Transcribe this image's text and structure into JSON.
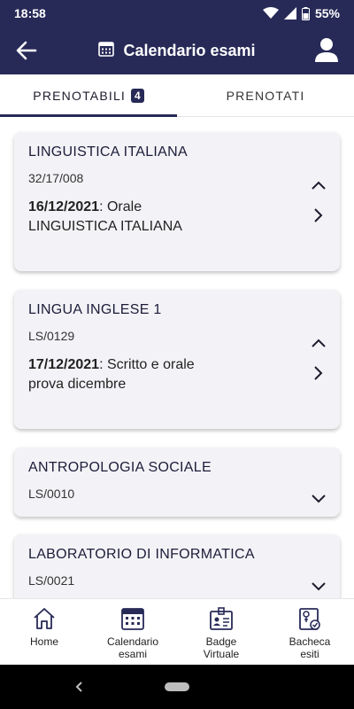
{
  "status_bar": {
    "time": "18:58",
    "battery": "55%",
    "icons": [
      "wifi-icon",
      "signal-icon",
      "battery-icon"
    ]
  },
  "header": {
    "title": "Calendario esami",
    "icons": [
      "back-arrow-icon",
      "calendar-icon",
      "profile-icon"
    ]
  },
  "tabs": [
    {
      "label": "PRENOTABILI",
      "badge": "4",
      "active": true
    },
    {
      "label": "PRENOTATI",
      "active": false
    }
  ],
  "cards": [
    {
      "title": "LINGUISTICA ITALIANA",
      "code": "32/17/008",
      "expanded": true,
      "exam": {
        "date": "16/12/2021",
        "type": ": Orale",
        "description": "LINGUISTICA ITALIANA"
      }
    },
    {
      "title": "LINGUA INGLESE 1",
      "code": "LS/0129",
      "expanded": true,
      "exam": {
        "date": "17/12/2021",
        "type": ": Scritto e orale",
        "description": "prova dicembre"
      }
    },
    {
      "title": "ANTROPOLOGIA SOCIALE",
      "code": "LS/0010",
      "expanded": false
    },
    {
      "title": "LABORATORIO DI INFORMATICA",
      "code": "LS/0021",
      "expanded": false
    }
  ],
  "bottom_nav": [
    {
      "label": "Home",
      "icon": "home-icon"
    },
    {
      "label": "Calendario\nesami",
      "icon": "calendar-icon"
    },
    {
      "label": "Badge\nVirtuale",
      "icon": "badge-icon"
    },
    {
      "label": "Bacheca\nesiti",
      "icon": "results-board-icon"
    }
  ],
  "colors": {
    "primary": "#272a57",
    "card_background": "#f3f3f7",
    "text": "#222222"
  }
}
